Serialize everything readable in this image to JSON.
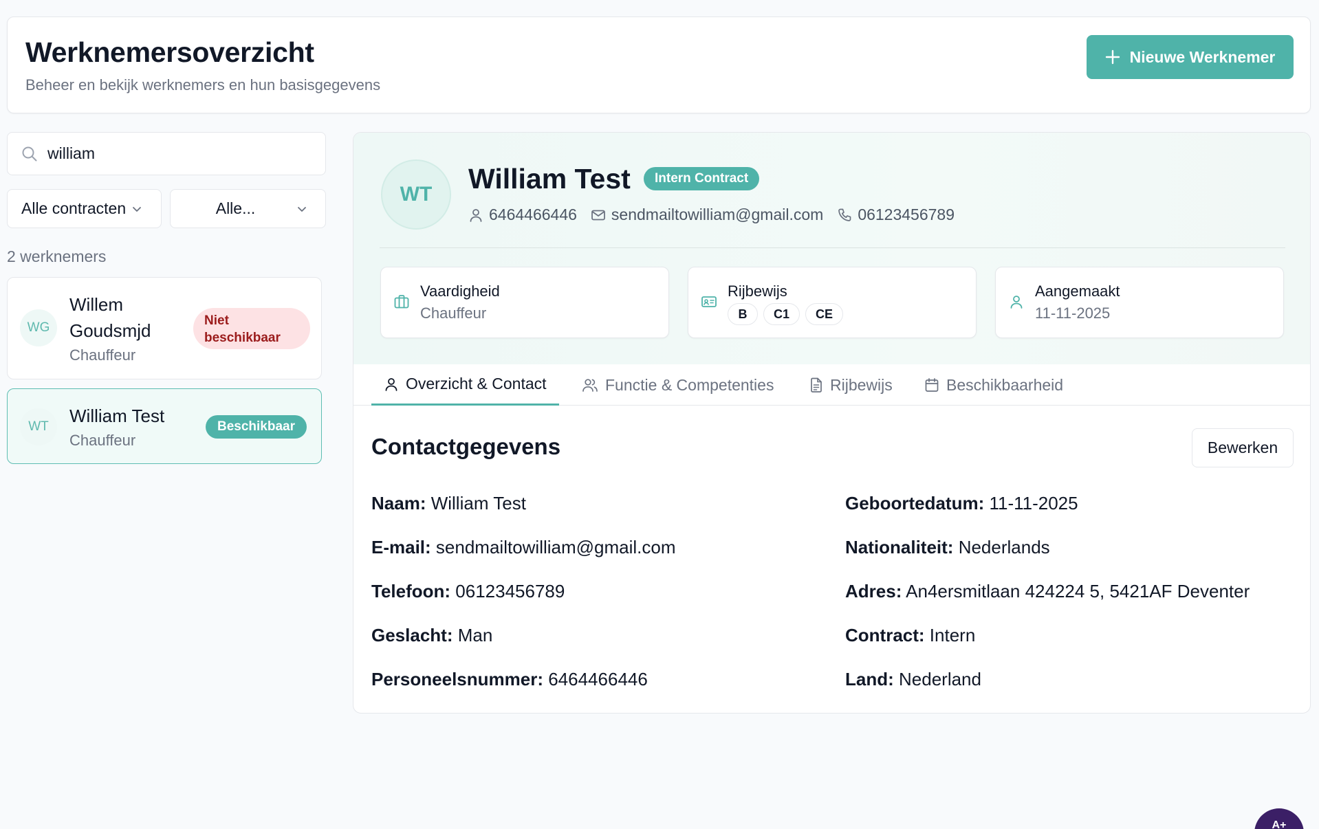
{
  "header": {
    "title": "Werknemersoverzicht",
    "subtitle": "Beheer en bekijk werknemers en hun basisgegevens",
    "new_button_label": "Nieuwe Werknemer"
  },
  "filters": {
    "search_value": "william",
    "contract_select": "Alle contracten",
    "status_select": "Alle..."
  },
  "list": {
    "count_label": "2 werknemers",
    "employees": [
      {
        "initials": "WG",
        "name": "Willem Goudsmjd",
        "role": "Chauffeur",
        "status": "Niet beschikbaar"
      },
      {
        "initials": "WT",
        "name": "William Test",
        "role": "Chauffeur",
        "status": "Beschikbaar"
      }
    ]
  },
  "detail": {
    "initials": "WT",
    "name": "William Test",
    "contract_badge": "Intern Contract",
    "personnel_number": "6464466446",
    "email": "sendmailtowilliam@gmail.com",
    "phone": "06123456789",
    "cards": {
      "skill_label": "Vaardigheid",
      "skill_value": "Chauffeur",
      "license_label": "Rijbewijs",
      "licenses": [
        "B",
        "C1",
        "CE"
      ],
      "created_label": "Aangemaakt",
      "created_value": "11-11-2025"
    },
    "tabs": [
      "Overzicht & Contact",
      "Functie & Competenties",
      "Rijbewijs",
      "Beschikbaarheid"
    ],
    "section_title": "Contactgegevens",
    "edit_label": "Bewerken",
    "fields_left": [
      {
        "label": "Naam:",
        "value": "William Test"
      },
      {
        "label": "E-mail:",
        "value": "sendmailtowilliam@gmail.com"
      },
      {
        "label": "Telefoon:",
        "value": "06123456789"
      },
      {
        "label": "Geslacht:",
        "value": "Man"
      },
      {
        "label": "Personeelsnummer:",
        "value": "6464466446"
      }
    ],
    "fields_right": [
      {
        "label": "Geboortedatum:",
        "value": "11-11-2025"
      },
      {
        "label": "Nationaliteit:",
        "value": "Nederlands"
      },
      {
        "label": "Adres:",
        "value": "An4ersmitlaan 424224 5, 5421AF Deventer"
      },
      {
        "label": "Contract:",
        "value": "Intern"
      },
      {
        "label": "Land:",
        "value": "Nederland"
      }
    ]
  },
  "fab": {
    "label": "A+"
  },
  "colors": {
    "accent": "#4fb3a9",
    "danger_bg": "#fde2e4",
    "danger_text": "#9b1c1c"
  }
}
